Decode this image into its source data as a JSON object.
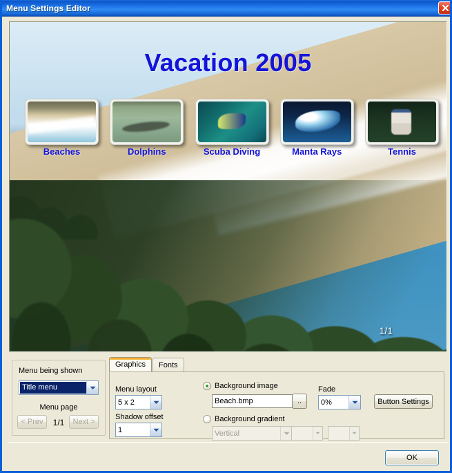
{
  "window": {
    "title": "Menu Settings Editor",
    "close_icon": "close-icon"
  },
  "preview": {
    "menu_title": "Vacation 2005",
    "page_indicator": "1/1",
    "buttons": [
      {
        "label": "Beaches",
        "art": "t-beach"
      },
      {
        "label": "Dolphins",
        "art": "t-dolphin"
      },
      {
        "label": "Scuba Diving",
        "art": "t-scuba"
      },
      {
        "label": "Manta Rays",
        "art": "t-manta"
      },
      {
        "label": "Tennis",
        "art": "t-tennis"
      }
    ],
    "colors": {
      "title_text": "#1414d8",
      "label_text": "#1414d8",
      "page_text": "#ffffff"
    }
  },
  "menu_panel": {
    "menu_being_shown_label": "Menu being shown",
    "menu_being_shown_value": "Title menu",
    "menu_page_label": "Menu page",
    "prev_label": "< Prev",
    "page_value": "1/1",
    "next_label": "Next >"
  },
  "tabs": [
    {
      "label": "Graphics",
      "active": true
    },
    {
      "label": "Fonts",
      "active": false
    }
  ],
  "graphics_tab": {
    "menu_layout_label": "Menu layout",
    "menu_layout_value": "5 x 2",
    "shadow_offset_label": "Shadow offset",
    "shadow_offset_value": "1",
    "background_image_label": "Background image",
    "background_image_value": "Beach.bmp",
    "browse_label": "..",
    "background_gradient_label": "Background gradient",
    "gradient_direction_value": "Vertical",
    "gradient_color1_value": "",
    "gradient_color2_value": "",
    "fade_label": "Fade",
    "fade_value": "0%",
    "button_settings_label": "Button Settings"
  },
  "footer": {
    "ok_label": "OK"
  }
}
